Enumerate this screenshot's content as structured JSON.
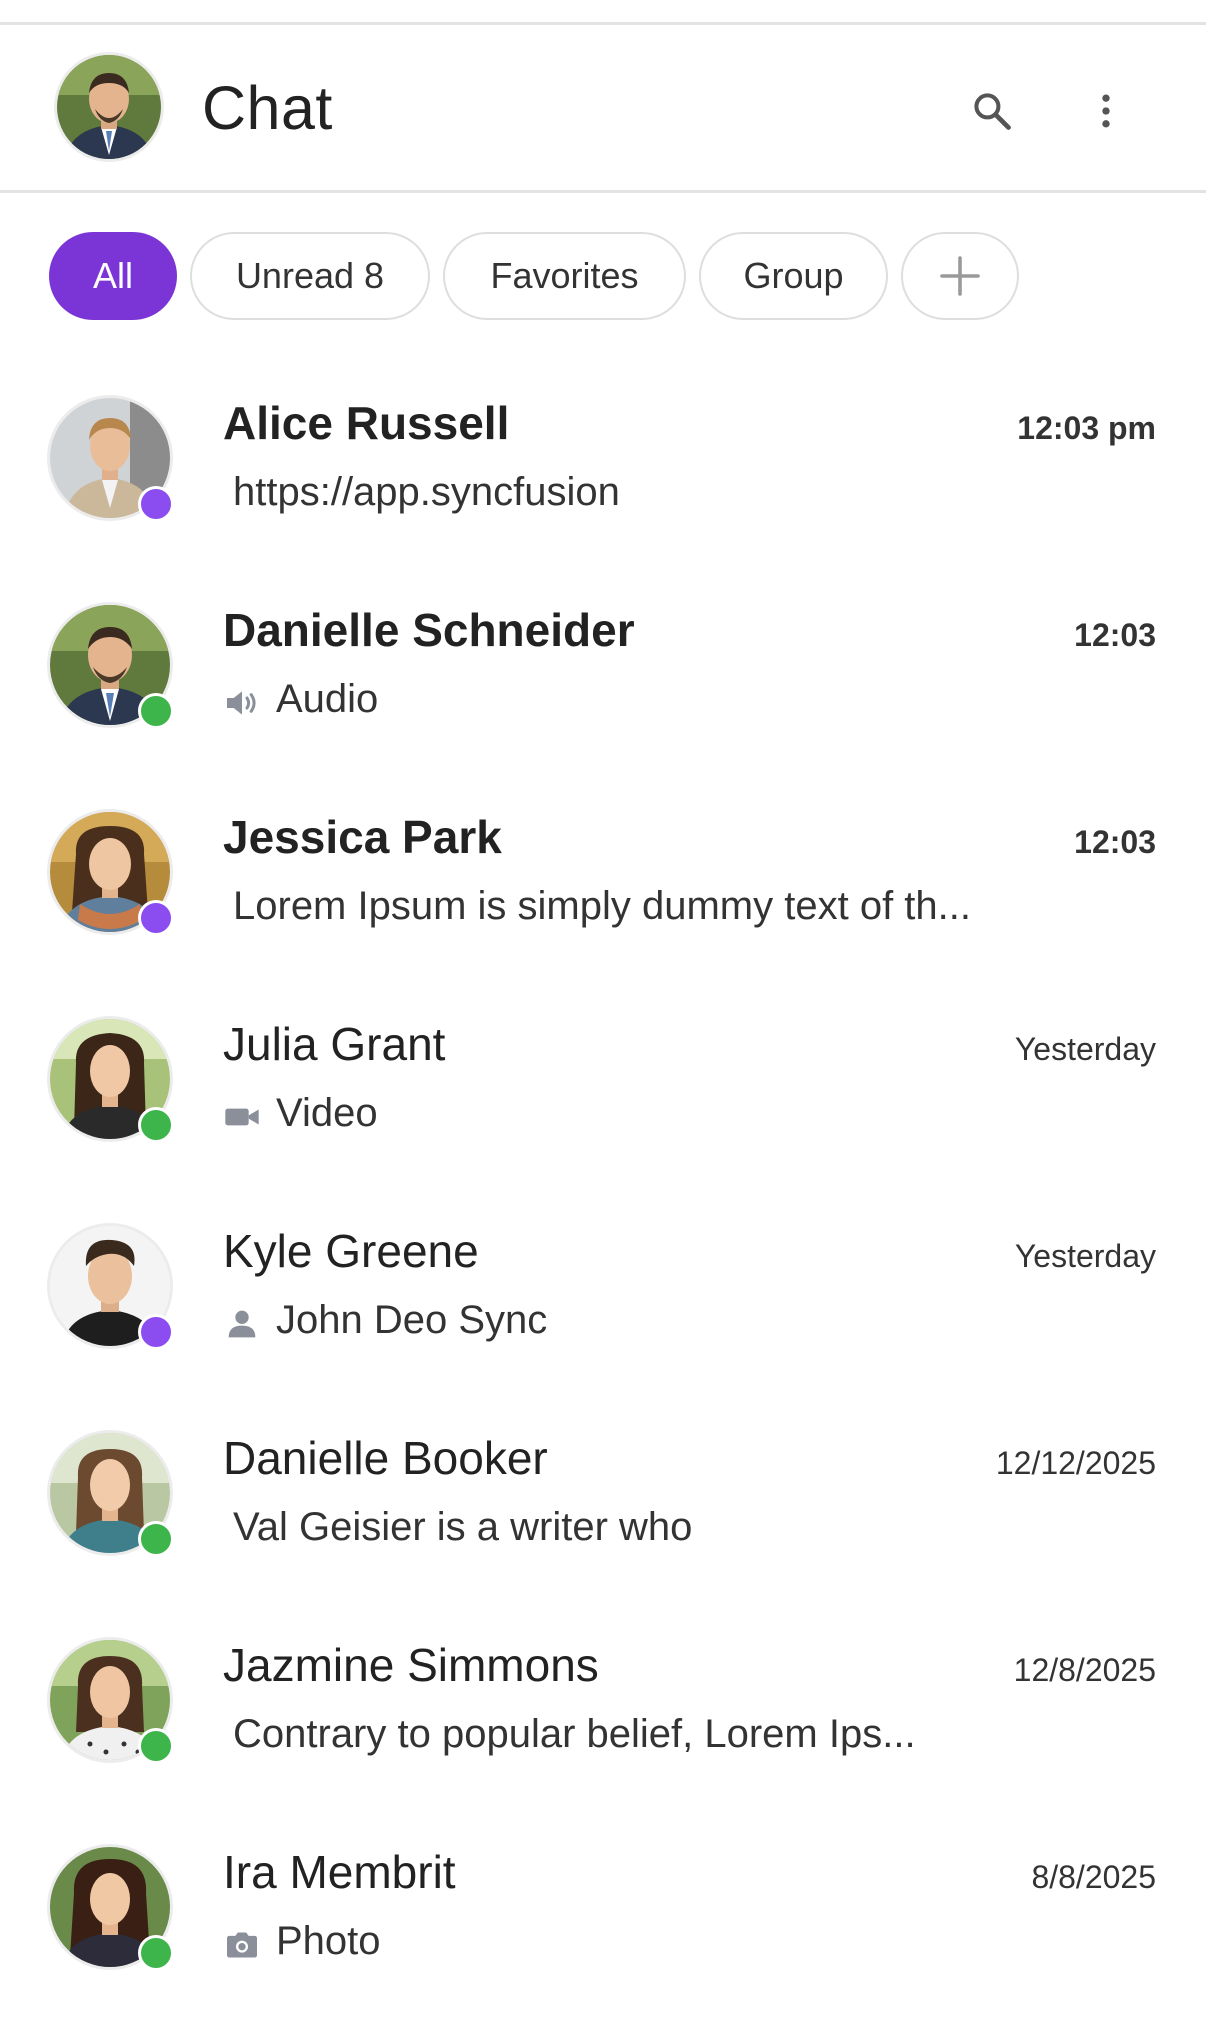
{
  "header": {
    "title": "Chat",
    "search_icon": "search-icon",
    "more_icon": "more-vertical-icon"
  },
  "filters": [
    {
      "label": "All",
      "count": "",
      "active": true
    },
    {
      "label": "Unread",
      "count": "8",
      "active": false
    },
    {
      "label": "Favorites",
      "count": "",
      "active": false
    },
    {
      "label": "Group",
      "count": "",
      "active": false
    }
  ],
  "add_filter_icon": "plus-icon",
  "colors": {
    "accent": "#7b35d6",
    "status_purple": "#8b4cf0",
    "status_green": "#3db54a",
    "icon_grey": "#8a8f99"
  },
  "chats": [
    {
      "name": "Alice Russell",
      "preview": "https://app.syncfusion",
      "preview_icon": "",
      "time": "12:03 pm",
      "unread": true,
      "status": "purple"
    },
    {
      "name": "Danielle Schneider",
      "preview": "Audio",
      "preview_icon": "speaker-icon",
      "time": "12:03",
      "unread": true,
      "status": "green"
    },
    {
      "name": "Jessica Park",
      "preview": "Lorem Ipsum is simply dummy text of th...",
      "preview_icon": "",
      "time": "12:03",
      "unread": true,
      "status": "purple"
    },
    {
      "name": "Julia Grant",
      "preview": "Video",
      "preview_icon": "video-camera-icon",
      "time": "Yesterday",
      "unread": false,
      "status": "green"
    },
    {
      "name": "Kyle Greene",
      "preview": "John Deo Sync",
      "preview_icon": "person-icon",
      "time": "Yesterday",
      "unread": false,
      "status": "purple"
    },
    {
      "name": "Danielle Booker",
      "preview": "Val Geisier is a writer who",
      "preview_icon": "",
      "time": "12/12/2025",
      "unread": false,
      "status": "green"
    },
    {
      "name": "Jazmine Simmons",
      "preview": "Contrary to popular belief, Lorem Ips...",
      "preview_icon": "",
      "time": "12/8/2025",
      "unread": false,
      "status": "green"
    },
    {
      "name": "Ira Membrit",
      "preview": "Photo",
      "preview_icon": "camera-icon",
      "time": "8/8/2025",
      "unread": false,
      "status": "green"
    }
  ]
}
